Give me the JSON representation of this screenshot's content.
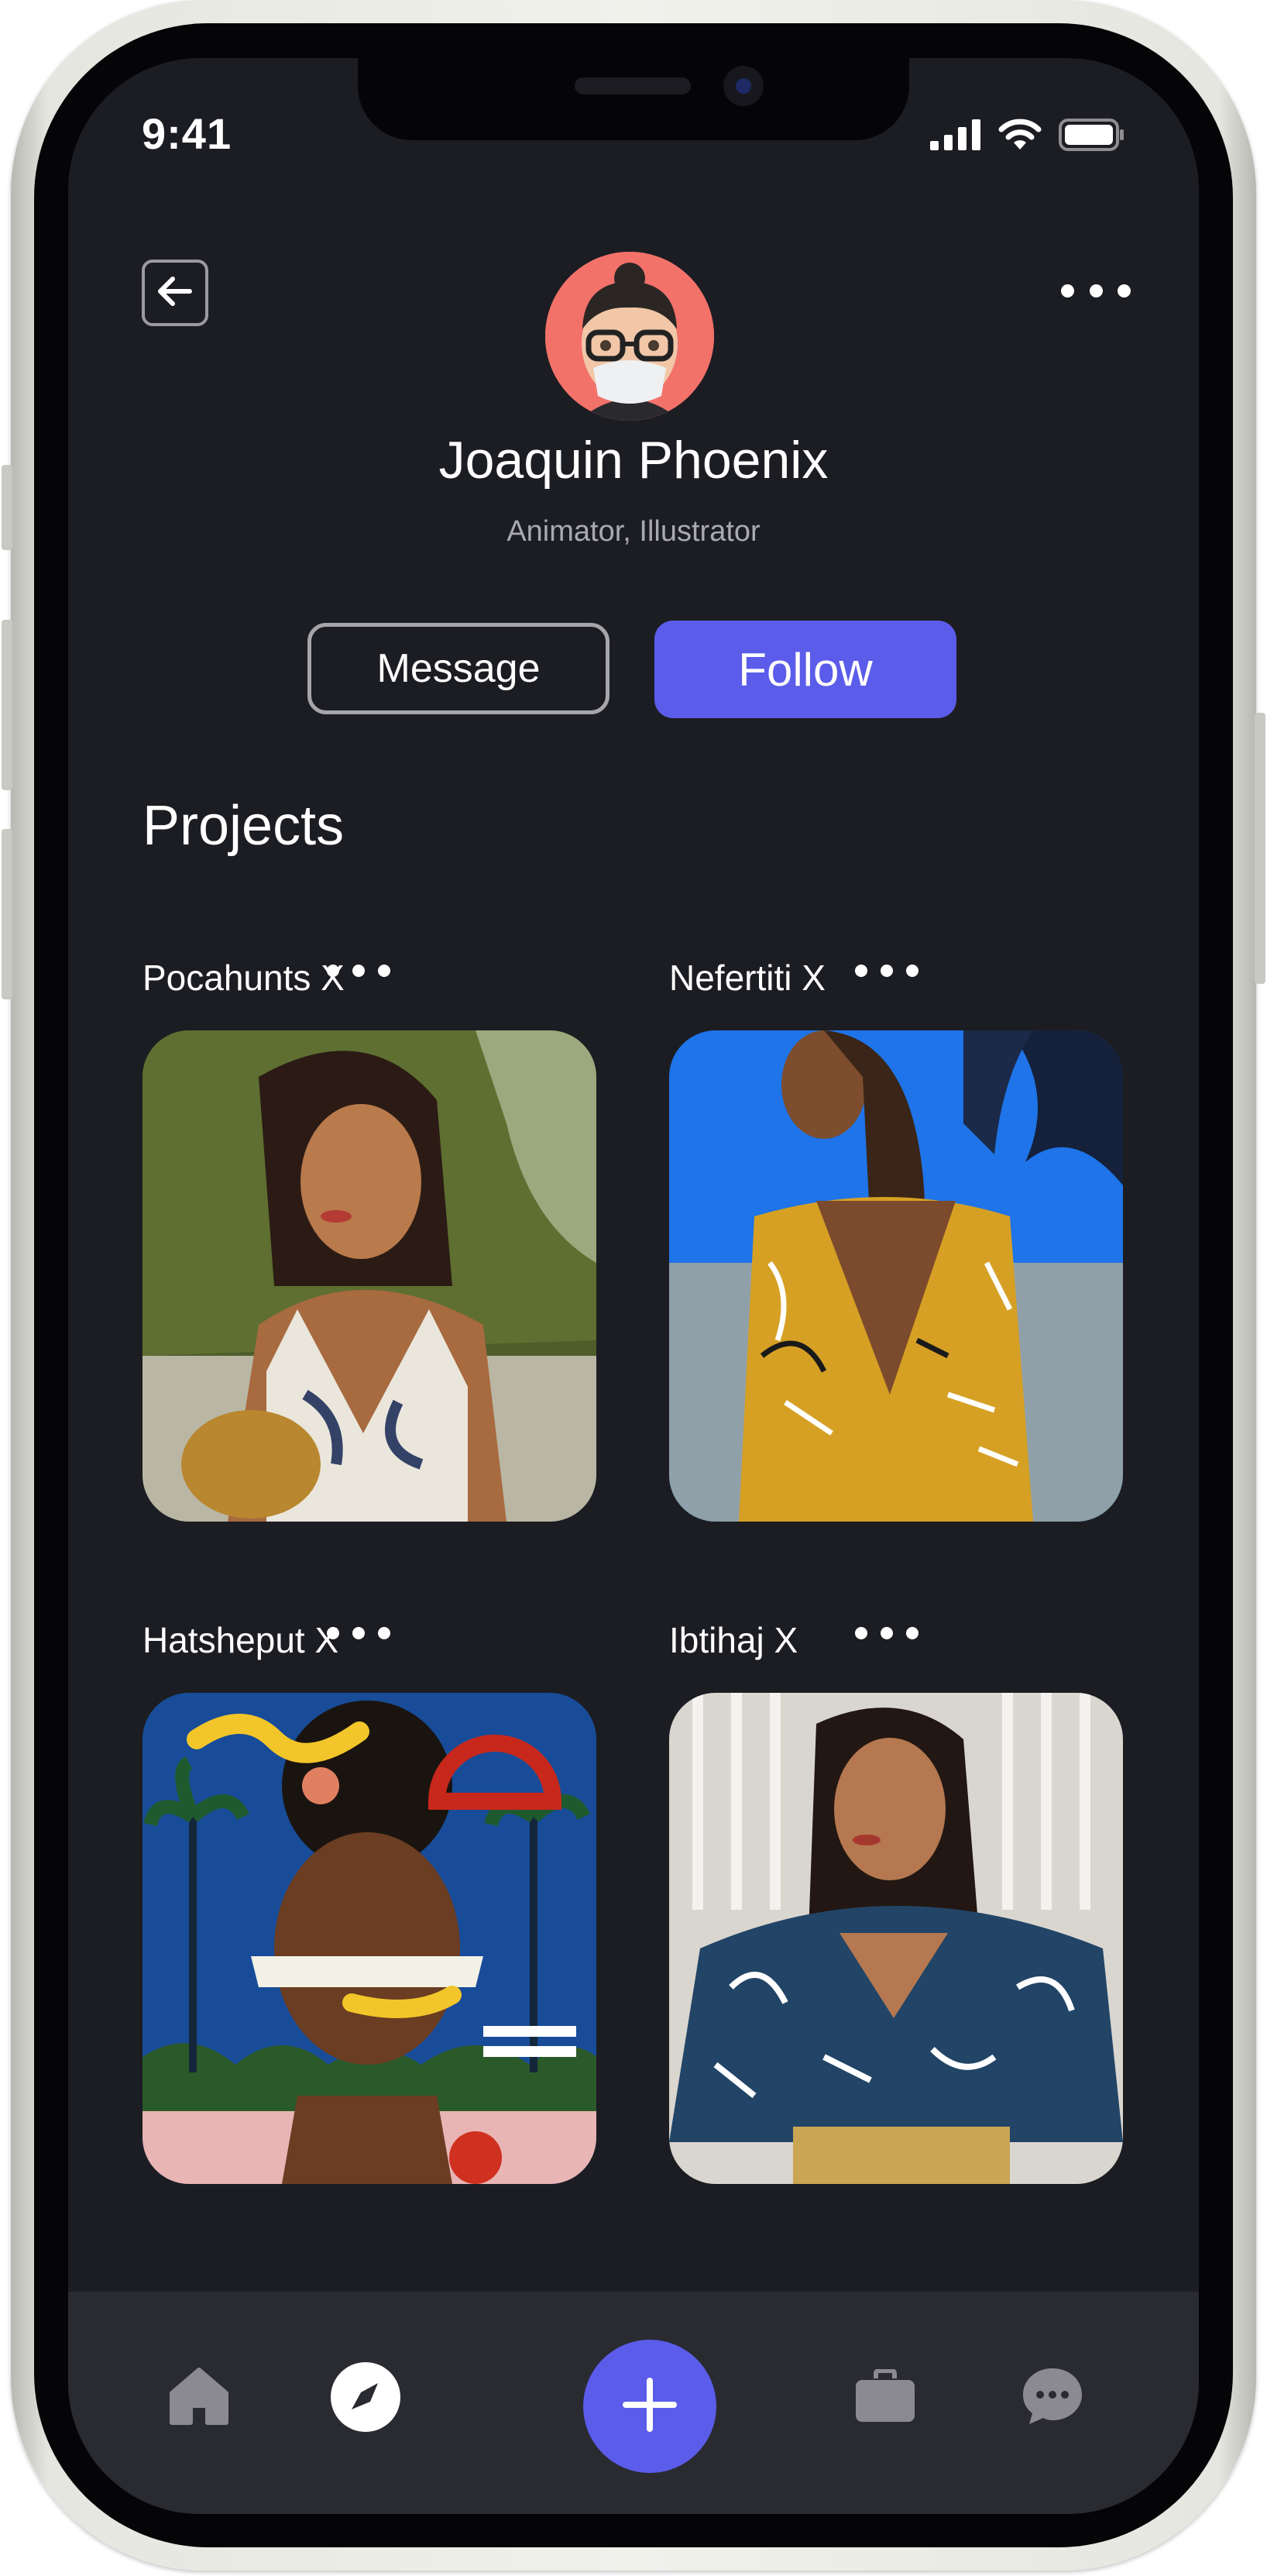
{
  "status_bar": {
    "time": "9:41"
  },
  "header": {
    "back_icon": "arrow-left-icon",
    "more_icon": "more-horizontal-icon"
  },
  "profile": {
    "name": "Joaquin Phoenix",
    "role": "Animator, Illustrator",
    "avatar_bg": "#f2726a"
  },
  "actions": {
    "message_label": "Message",
    "follow_label": "Follow",
    "accent_color": "#5b5cea"
  },
  "projects": {
    "title": "Projects",
    "items": [
      {
        "title": "Pocahunts X"
      },
      {
        "title": "Nefertiti X"
      },
      {
        "title": "Hatsheput X"
      },
      {
        "title": "Ibtihaj X"
      }
    ]
  },
  "bottom_nav": {
    "items": [
      "home-icon",
      "compass-icon",
      "plus-icon",
      "briefcase-icon",
      "chat-icon"
    ]
  }
}
